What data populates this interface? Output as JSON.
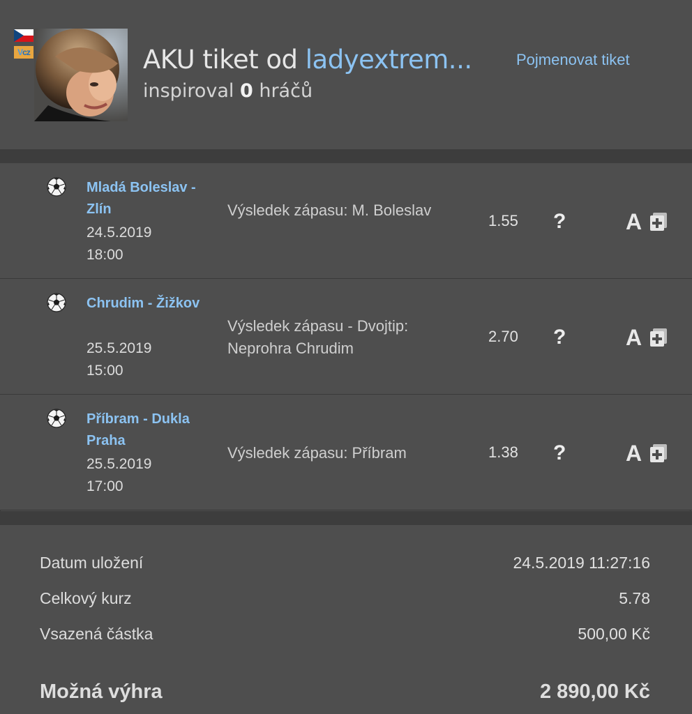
{
  "header": {
    "title_prefix": "AKU tiket od ",
    "username": "ladyextrem...",
    "inspired_prefix": "inspiroval ",
    "inspired_count": "0",
    "inspired_suffix": " hráčů",
    "rename_link": "Pojmenovat tiket",
    "badge": "cz",
    "badge_prefix": "V"
  },
  "bets": [
    {
      "match": "Mladá Boleslav - Zlín",
      "date": "24.5.2019",
      "time": "18:00",
      "pick": "Výsledek zápasu: M. Boleslav",
      "odds": "1.55",
      "help": "?",
      "bet_letter": "A",
      "icon": "soccer-ball-icon"
    },
    {
      "match": "Chrudim - Žižkov",
      "date": "25.5.2019",
      "time": "15:00",
      "pick": "Výsledek zápasu - Dvojtip: Neprohra Chrudim",
      "odds": "2.70",
      "help": "?",
      "bet_letter": "A",
      "icon": "soccer-ball-icon"
    },
    {
      "match": "Příbram - Dukla Praha",
      "date": "25.5.2019",
      "time": "17:00",
      "pick": "Výsledek zápasu: Příbram",
      "odds": "1.38",
      "help": "?",
      "bet_letter": "A",
      "icon": "soccer-ball-icon"
    }
  ],
  "summary": {
    "saved_label": "Datum uložení",
    "saved_value": "24.5.2019 11:27:16",
    "total_odds_label": "Celkový kurz",
    "total_odds_value": "5.78",
    "stake_label": "Vsazená částka",
    "stake_value": "500,00 Kč",
    "win_label": "Možná výhra",
    "win_value": "2 890,00 Kč"
  },
  "colors": {
    "background": "#4e4e4e",
    "separator": "#3d3d3d",
    "link": "#8cc3f2"
  }
}
